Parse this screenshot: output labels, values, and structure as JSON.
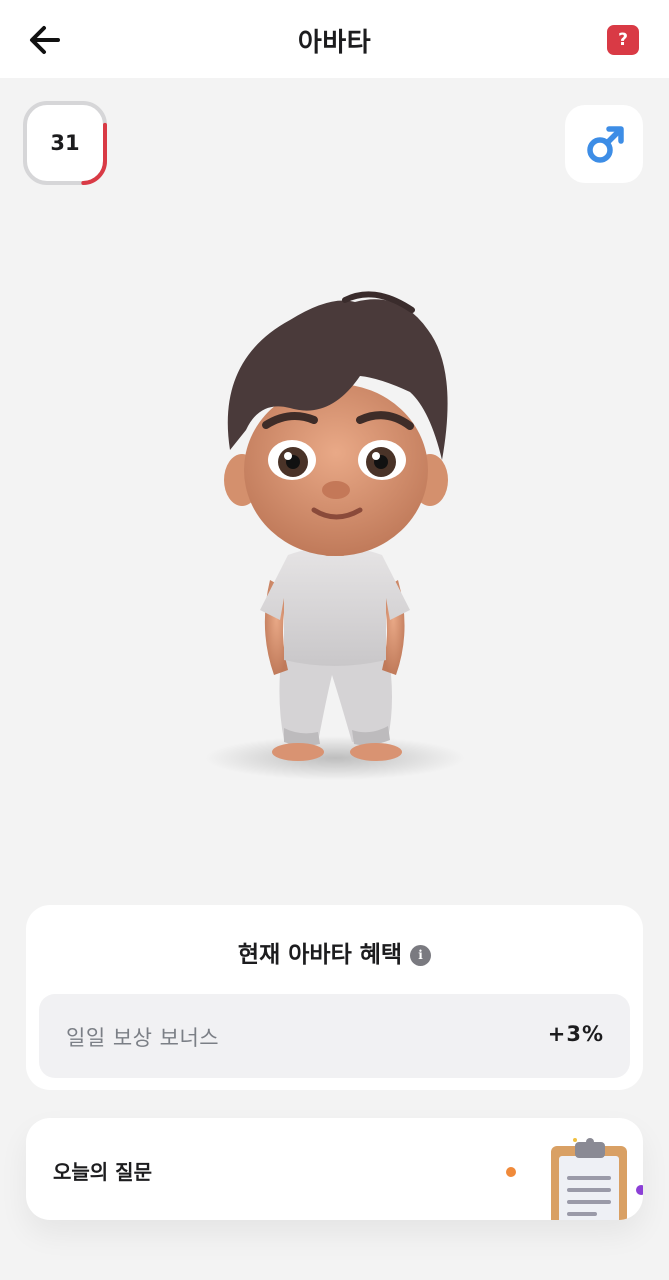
{
  "header": {
    "title": "아바타",
    "help_label": "?"
  },
  "level": {
    "value": "31",
    "progress_fraction": 0.25,
    "progress_color": "#d93a45"
  },
  "gender": {
    "icon": "male-symbol-icon",
    "color": "#3d8de6"
  },
  "benefits": {
    "title": "현재 아바타 혜택",
    "items": [
      {
        "label": "일일 보상 보너스",
        "value": "+3%"
      }
    ]
  },
  "daily_question": {
    "label": "오늘의 질문",
    "icon": "clipboard-icon"
  },
  "colors": {
    "accent_red": "#d93a45",
    "background": "#f3f3f3",
    "card": "#ffffff"
  }
}
